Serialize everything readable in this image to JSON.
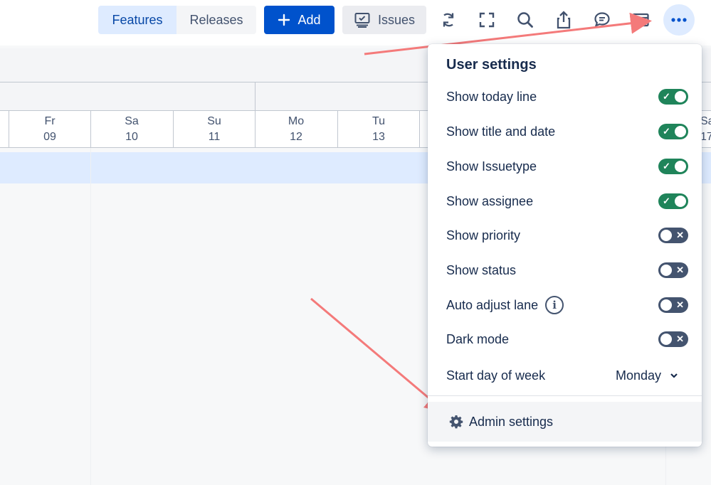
{
  "toolbar": {
    "tabs": [
      {
        "label": "Features",
        "active": true
      },
      {
        "label": "Releases",
        "active": false
      }
    ],
    "add_label": "Add",
    "issues_label": "Issues",
    "icons": [
      "refresh-icon",
      "fullscreen-icon",
      "search-icon",
      "share-icon",
      "comment-icon",
      "card-view-icon",
      "more-icon"
    ]
  },
  "timeline": {
    "days": [
      {
        "dow": "Fr",
        "date": "09"
      },
      {
        "dow": "Sa",
        "date": "10"
      },
      {
        "dow": "Su",
        "date": "11"
      },
      {
        "dow": "Mo",
        "date": "12"
      },
      {
        "dow": "Tu",
        "date": "13"
      },
      {
        "dow": "Sa",
        "date": "17"
      }
    ]
  },
  "settings": {
    "title": "User settings",
    "options": [
      {
        "label": "Show today line",
        "enabled": true
      },
      {
        "label": "Show title and date",
        "enabled": true
      },
      {
        "label": "Show Issuetype",
        "enabled": true
      },
      {
        "label": "Show assignee",
        "enabled": true
      },
      {
        "label": "Show priority",
        "enabled": false
      },
      {
        "label": "Show status",
        "enabled": false
      },
      {
        "label": "Auto adjust lane",
        "enabled": false,
        "info": true
      },
      {
        "label": "Dark mode",
        "enabled": false
      }
    ],
    "start_day_label": "Start day of week",
    "start_day_value": "Monday",
    "admin_label": "Admin settings"
  },
  "colors": {
    "accent": "#0052cc",
    "toggle_on": "#1f845a",
    "toggle_off": "#44546f",
    "annotation_arrow": "#f47a7a",
    "lane": "#deebff"
  }
}
